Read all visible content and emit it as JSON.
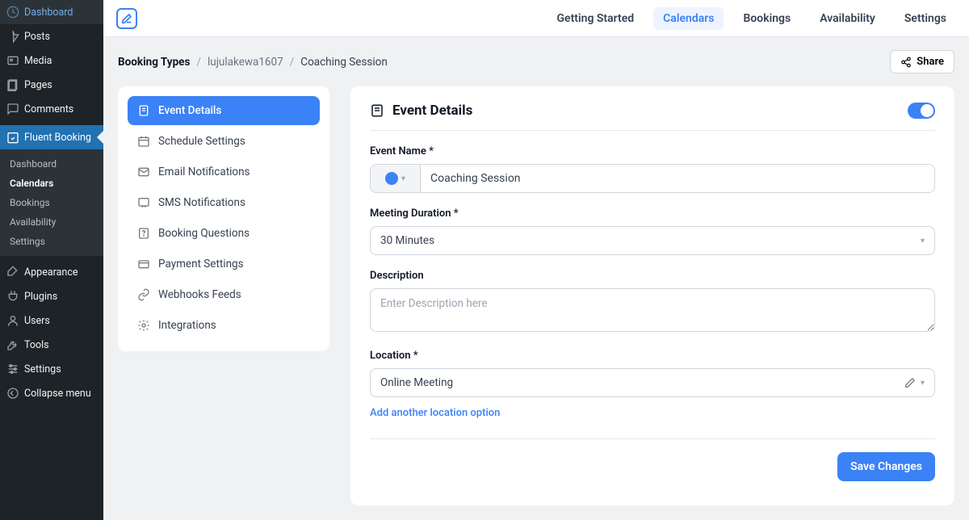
{
  "wp_sidebar": {
    "items_top": [
      {
        "label": "Dashboard",
        "icon": "gauge"
      },
      {
        "label": "Posts",
        "icon": "pin"
      },
      {
        "label": "Media",
        "icon": "media"
      },
      {
        "label": "Pages",
        "icon": "page"
      },
      {
        "label": "Comments",
        "icon": "comment"
      }
    ],
    "active": {
      "label": "Fluent Booking",
      "icon": "cal-check"
    },
    "sub": [
      {
        "label": "Dashboard"
      },
      {
        "label": "Calendars",
        "current": true
      },
      {
        "label": "Bookings"
      },
      {
        "label": "Availability"
      },
      {
        "label": "Settings"
      }
    ],
    "items_bottom": [
      {
        "label": "Appearance",
        "icon": "brush"
      },
      {
        "label": "Plugins",
        "icon": "plug"
      },
      {
        "label": "Users",
        "icon": "user"
      },
      {
        "label": "Tools",
        "icon": "wrench"
      },
      {
        "label": "Settings",
        "icon": "sliders"
      },
      {
        "label": "Collapse menu",
        "icon": "collapse"
      }
    ]
  },
  "topnav": {
    "items": [
      {
        "label": "Getting Started"
      },
      {
        "label": "Calendars",
        "active": true
      },
      {
        "label": "Bookings"
      },
      {
        "label": "Availability"
      },
      {
        "label": "Settings"
      }
    ]
  },
  "breadcrumb": {
    "root": "Booking Types",
    "middle": "lujulakewa1607",
    "current": "Coaching Session"
  },
  "share_label": "Share",
  "left_nav": [
    {
      "label": "Event Details",
      "icon": "doc",
      "active": true
    },
    {
      "label": "Schedule Settings",
      "icon": "calendar"
    },
    {
      "label": "Email Notifications",
      "icon": "mail"
    },
    {
      "label": "SMS Notifications",
      "icon": "sms"
    },
    {
      "label": "Booking Questions",
      "icon": "question"
    },
    {
      "label": "Payment Settings",
      "icon": "card"
    },
    {
      "label": "Webhooks Feeds",
      "icon": "link"
    },
    {
      "label": "Integrations",
      "icon": "gear"
    }
  ],
  "panel": {
    "title": "Event Details",
    "event_name_label": "Event Name *",
    "event_name_value": "Coaching Session",
    "duration_label": "Meeting Duration *",
    "duration_value": "30 Minutes",
    "description_label": "Description",
    "description_placeholder": "Enter Description here",
    "location_label": "Location *",
    "location_value": "Online Meeting",
    "add_location_label": "Add another location option",
    "save_label": "Save Changes"
  }
}
